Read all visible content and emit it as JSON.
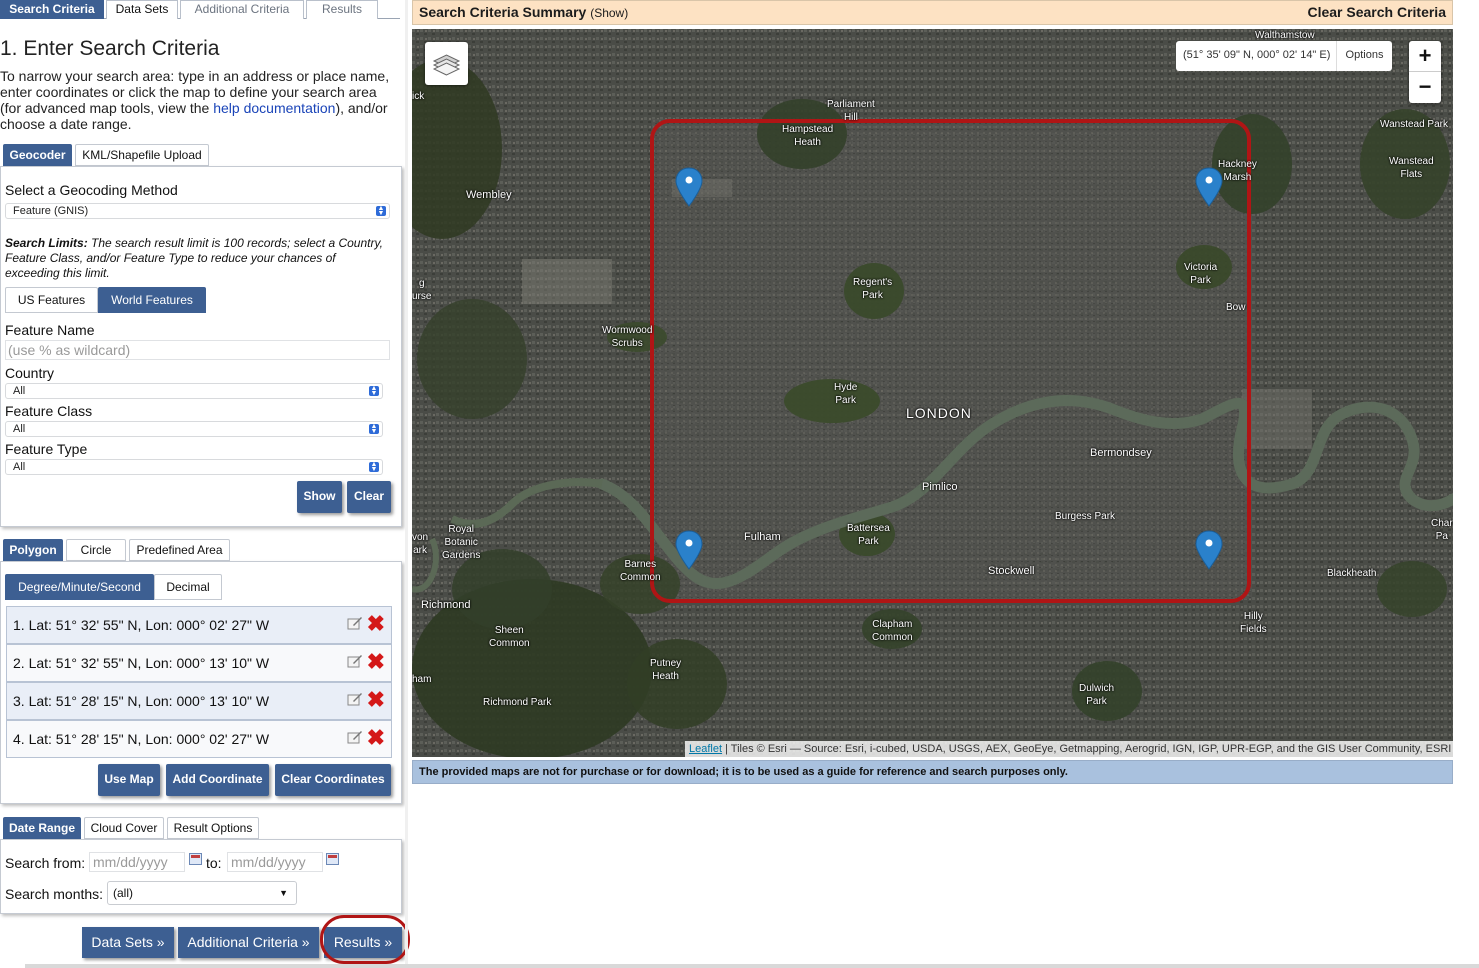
{
  "top_tabs": [
    {
      "label": "Search Criteria",
      "active": true
    },
    {
      "label": "Data Sets",
      "active": false
    },
    {
      "label": "Additional Criteria",
      "active": false
    },
    {
      "label": "Results",
      "active": false
    }
  ],
  "section": {
    "title": "1. Enter Search Criteria",
    "intro_before": "To narrow your search area: type in an address or place name, enter coordinates or click the map to define your search area (for advanced map tools, view the ",
    "intro_link": "help documentation",
    "intro_after": "), and/or choose a date range."
  },
  "geocoder_tabs": [
    {
      "label": "Geocoder",
      "active": true
    },
    {
      "label": "KML/Shapefile Upload",
      "active": false
    }
  ],
  "geocoder": {
    "method_label": "Select a Geocoding Method",
    "method_value": "Feature (GNIS)",
    "limits_title": "Search Limits:",
    "limits_text": " The search result limit is 100 records; select a Country, Feature Class, and/or Feature Type to reduce your chances of exceeding this limit.",
    "feature_tabs": [
      {
        "label": "US Features",
        "active": false
      },
      {
        "label": "World Features",
        "active": true
      }
    ],
    "feature_name_label": "Feature Name",
    "feature_name_placeholder": "(use % as wildcard)",
    "country_label": "Country",
    "country_value": "All",
    "feature_class_label": "Feature Class",
    "feature_class_value": "All",
    "feature_type_label": "Feature Type",
    "feature_type_value": "All",
    "show_button": "Show",
    "clear_button": "Clear"
  },
  "area_tabs": [
    {
      "label": "Polygon",
      "active": true
    },
    {
      "label": "Circle",
      "active": false
    },
    {
      "label": "Predefined Area",
      "active": false
    }
  ],
  "format_tabs": [
    {
      "label": "Degree/Minute/Second",
      "active": true
    },
    {
      "label": "Decimal",
      "active": false
    }
  ],
  "coordinates": [
    "1.  Lat: 51° 32' 55\" N, Lon: 000° 02' 27\" W",
    "2.  Lat: 51° 32' 55\" N, Lon: 000° 13' 10\" W",
    "3.  Lat: 51° 28' 15\" N, Lon: 000° 13' 10\" W",
    "4.  Lat: 51° 28' 15\" N, Lon: 000° 02' 27\" W"
  ],
  "coord_buttons": {
    "use_map": "Use Map",
    "add": "Add Coordinate",
    "clear": "Clear Coordinates"
  },
  "date_tabs": [
    {
      "label": "Date Range",
      "active": true
    },
    {
      "label": "Cloud Cover",
      "active": false
    },
    {
      "label": "Result Options",
      "active": false
    }
  ],
  "date_range": {
    "from_label": "Search from:",
    "from_placeholder": "mm/dd/yyyy",
    "to_label": "to:",
    "to_placeholder": "mm/dd/yyyy",
    "months_label": "Search months:",
    "months_value": "(all)"
  },
  "nav_buttons": {
    "data_sets": "Data Sets »",
    "additional": "Additional Criteria »",
    "results": "Results »"
  },
  "summary": {
    "title": "Search Criteria Summary",
    "show": "(Show)",
    "clear": "Clear Search Criteria"
  },
  "map": {
    "cursor_coords": "(51° 35' 09\" N, 000° 02' 14\" E)",
    "options_label": "Options",
    "zoom_in": "+",
    "zoom_out": "−",
    "labels": [
      "Walthamstow",
      "Parliament",
      "Hill",
      "Hampstead",
      "Heath",
      "Hackney",
      "Marsh",
      "Wanstead Park",
      "Wanstead",
      "Flats",
      "Wembley",
      "Regent's",
      "Park",
      "Victoria",
      "Park",
      "Bow",
      "Wormwood",
      "Scrubs",
      "Hyde",
      "Park",
      "LONDON",
      "Bermondsey",
      "Pimlico",
      "Burgess Park",
      "Royal",
      "Botanic",
      "Gardens",
      "Fulham",
      "Battersea",
      "Park",
      "Barnes",
      "Common",
      "Stockwell",
      "Blackheath",
      "Richmond",
      "Sheen",
      "Common",
      "Clapham",
      "Common",
      "Hilly",
      "Fields",
      "Putney",
      "Heath",
      "Dulwich",
      "Park",
      "Richmond Park",
      "ick",
      "g",
      "urse",
      "von",
      "ark",
      "ham",
      "Char",
      "Pa"
    ],
    "attribution_link": "Leaflet",
    "attribution_text": " | Tiles © Esri — Source: Esri, i-cubed, USDA, USGS, AEX, GeoEye, Getmapping, Aerogrid, IGN, IGP, UPR-EGP, and the GIS User Community, ESRI",
    "polygon_color": "#b01515",
    "marker_color": "#2a81cb"
  },
  "disclaimer": "The provided maps are not for purchase or for download; it is to be used as a guide for reference and search purposes only."
}
